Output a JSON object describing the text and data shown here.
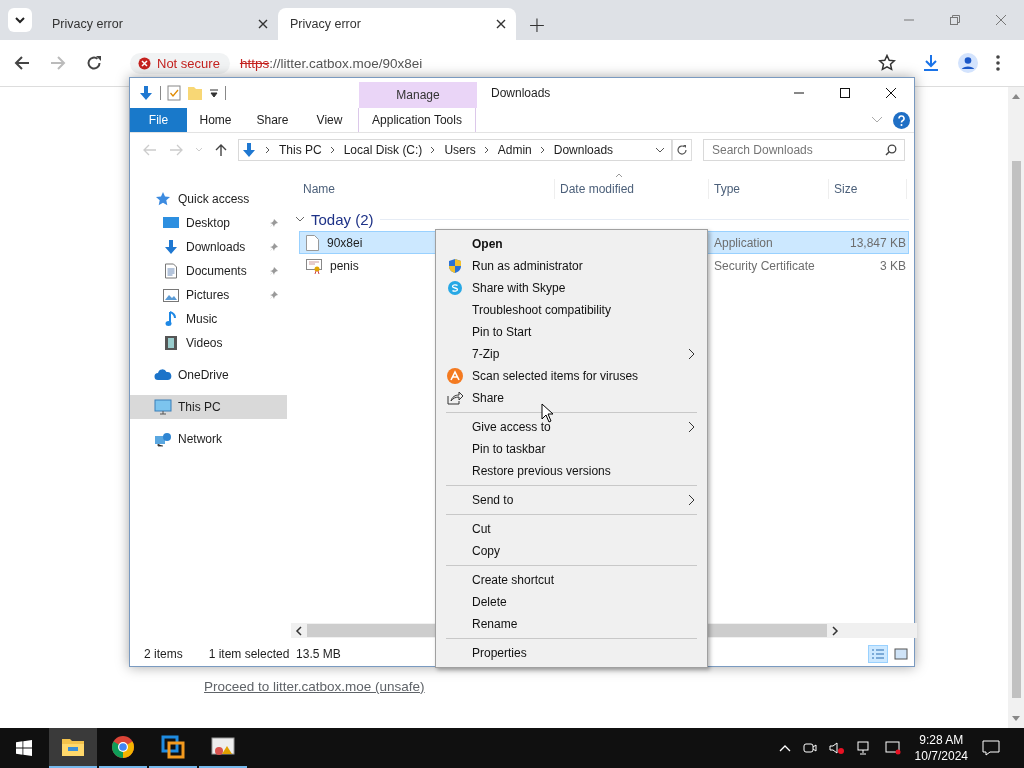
{
  "browser": {
    "tabs": [
      {
        "title": "Privacy error",
        "selected": false
      },
      {
        "title": "Privacy error",
        "selected": true
      }
    ],
    "new_tab": "+",
    "address": {
      "security": "Not secure",
      "scheme": "https",
      "rest": "://litter.catbox.moe/90x8ei"
    },
    "page_link": "Proceed to litter.catbox.moe (unsafe)"
  },
  "explorer": {
    "title": "Downloads",
    "tab_group": "Manage",
    "ribbon_tabs": [
      {
        "label": "File",
        "kind": "file"
      },
      {
        "label": "Home",
        "kind": "tab"
      },
      {
        "label": "Share",
        "kind": "tab"
      },
      {
        "label": "View",
        "kind": "tab"
      },
      {
        "label": "Application Tools",
        "kind": "contextual"
      }
    ],
    "breadcrumb": [
      "This PC",
      "Local Disk (C:)",
      "Users",
      "Admin",
      "Downloads"
    ],
    "search": {
      "placeholder": "Search Downloads"
    },
    "nav": [
      {
        "label": "Quick access",
        "kind": "star",
        "selected": false,
        "children": [
          {
            "label": "Desktop",
            "kind": "desktop",
            "pinned": true
          },
          {
            "label": "Downloads",
            "kind": "download",
            "pinned": true
          },
          {
            "label": "Documents",
            "kind": "document",
            "pinned": true
          },
          {
            "label": "Pictures",
            "kind": "pictures",
            "pinned": true
          },
          {
            "label": "Music",
            "kind": "music",
            "pinned": false
          },
          {
            "label": "Videos",
            "kind": "videos",
            "pinned": false
          }
        ]
      },
      {
        "label": "OneDrive",
        "kind": "cloud",
        "selected": false
      },
      {
        "label": "This PC",
        "kind": "pc",
        "selected": true
      },
      {
        "label": "Network",
        "kind": "network",
        "selected": false
      }
    ],
    "columns": [
      {
        "label": "Name",
        "sorted": false
      },
      {
        "label": "Date modified",
        "sorted": true
      },
      {
        "label": "Type",
        "sorted": false
      },
      {
        "label": "Size",
        "sorted": false
      }
    ],
    "group": {
      "label": "Today (2)",
      "expanded": true
    },
    "files": [
      {
        "name": "90x8ei",
        "kind": "app",
        "type": "Application",
        "size": "13,847 KB",
        "selected": true
      },
      {
        "name": "penis",
        "kind": "cert",
        "type": "Security Certificate",
        "size": "3 KB",
        "selected": false
      }
    ],
    "status": {
      "count": "2 items",
      "selection": "1 item selected  13.5 MB"
    },
    "views": [
      {
        "kind": "details",
        "selected": true
      },
      {
        "kind": "large",
        "selected": false
      }
    ]
  },
  "context_menu": [
    {
      "kind": "plain",
      "label": "Open",
      "bold": true,
      "submenu": false
    },
    {
      "kind": "shield",
      "label": "Run as administrator",
      "bold": false,
      "submenu": false
    },
    {
      "kind": "skype",
      "label": "Share with Skype",
      "bold": false,
      "submenu": false
    },
    {
      "kind": "plain",
      "label": "Troubleshoot compatibility",
      "bold": false,
      "submenu": false
    },
    {
      "kind": "plain",
      "label": "Pin to Start",
      "bold": false,
      "submenu": false
    },
    {
      "kind": "plain",
      "label": "7-Zip",
      "bold": false,
      "submenu": true
    },
    {
      "kind": "avast",
      "label": "Scan selected items for viruses",
      "bold": false,
      "submenu": false
    },
    {
      "kind": "share",
      "label": "Share",
      "bold": false,
      "submenu": false
    },
    {
      "kind": "separator"
    },
    {
      "kind": "plain",
      "label": "Give access to",
      "bold": false,
      "submenu": true
    },
    {
      "kind": "plain",
      "label": "Pin to taskbar",
      "bold": false,
      "submenu": false
    },
    {
      "kind": "plain",
      "label": "Restore previous versions",
      "bold": false,
      "submenu": false
    },
    {
      "kind": "separator"
    },
    {
      "kind": "plain",
      "label": "Send to",
      "bold": false,
      "submenu": true
    },
    {
      "kind": "separator"
    },
    {
      "kind": "plain",
      "label": "Cut",
      "bold": false,
      "submenu": false
    },
    {
      "kind": "plain",
      "label": "Copy",
      "bold": false,
      "submenu": false
    },
    {
      "kind": "separator"
    },
    {
      "kind": "plain",
      "label": "Create shortcut",
      "bold": false,
      "submenu": false
    },
    {
      "kind": "plain",
      "label": "Delete",
      "bold": false,
      "submenu": false
    },
    {
      "kind": "plain",
      "label": "Rename",
      "bold": false,
      "submenu": false
    },
    {
      "kind": "separator"
    },
    {
      "kind": "plain",
      "label": "Properties",
      "bold": false,
      "submenu": false
    }
  ],
  "taskbar": {
    "apps": [
      {
        "kind": "explorer",
        "active": true
      },
      {
        "kind": "chrome",
        "active": false
      },
      {
        "kind": "vm",
        "active": false
      },
      {
        "kind": "certapp",
        "active": false
      }
    ],
    "time": "9:28 AM",
    "date": "10/7/2024"
  }
}
